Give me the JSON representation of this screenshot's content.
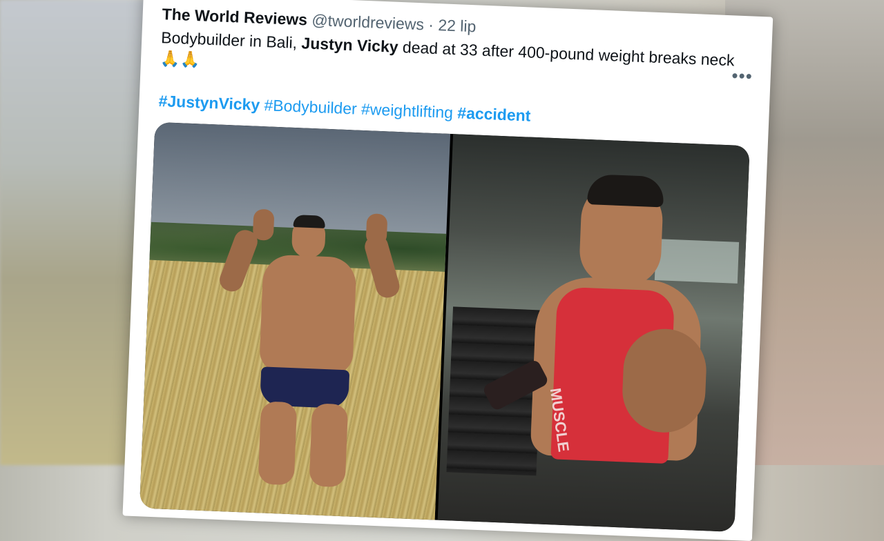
{
  "tweet": {
    "author_name": "The World Reviews",
    "handle": "@tworldreviews",
    "separator": "·",
    "date": "22 lip",
    "more_label": "•••",
    "text_part1": "Bodybuilder in Bali, ",
    "text_bold": "Justyn Vicky",
    "text_part2": " dead at 33 after 400-pound weight breaks neck ",
    "emoji": "🙏🙏",
    "hashtags": [
      {
        "text": "#JustynVicky",
        "bold": true
      },
      {
        "text": "#Bodybuilder",
        "bold": false
      },
      {
        "text": "#weightlifting",
        "bold": false
      },
      {
        "text": "#accident",
        "bold": true
      }
    ],
    "tank_text": "MUSCLE"
  },
  "colors": {
    "link": "#1d9bf0",
    "text": "#0f1419",
    "muted": "#536471"
  }
}
